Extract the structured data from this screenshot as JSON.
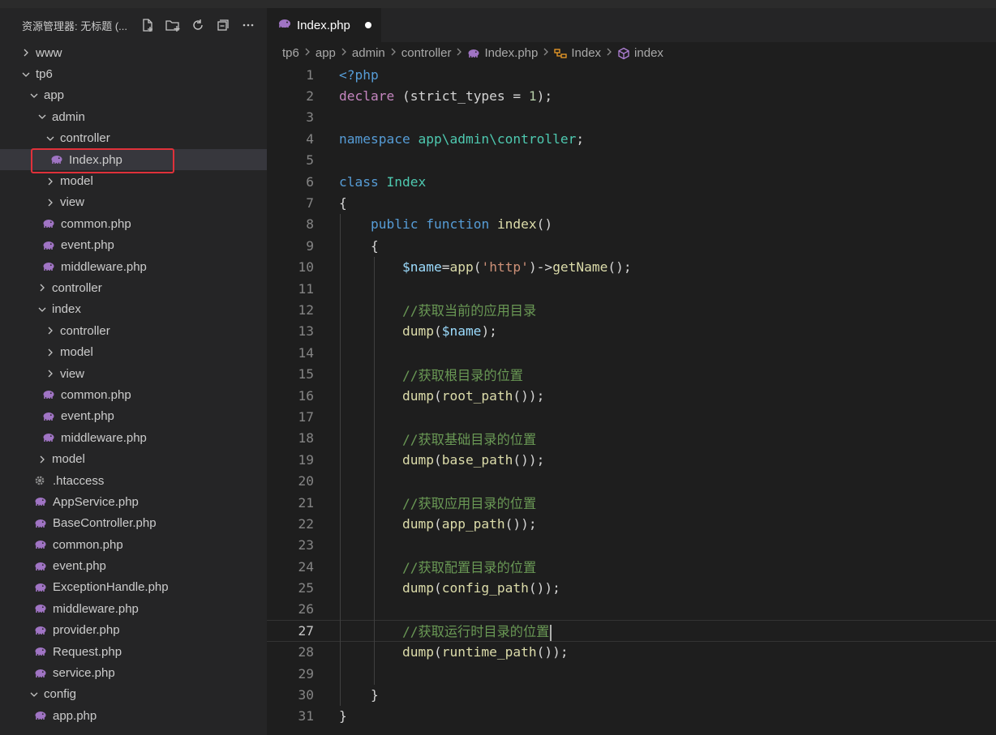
{
  "sidebar": {
    "title": "资源管理器: 无标题 (...",
    "actions": [
      "new-file-icon",
      "new-folder-icon",
      "refresh-icon",
      "collapse-all-icon",
      "more-icon"
    ],
    "tree": [
      {
        "label": "www",
        "type": "folder",
        "open": false,
        "indent": 0
      },
      {
        "label": "tp6",
        "type": "folder",
        "open": true,
        "indent": 0
      },
      {
        "label": "app",
        "type": "folder",
        "open": true,
        "indent": 1
      },
      {
        "label": "admin",
        "type": "folder",
        "open": true,
        "indent": 2
      },
      {
        "label": "controller",
        "type": "folder",
        "open": true,
        "indent": 3
      },
      {
        "label": "Index.php",
        "type": "php",
        "indent": 4,
        "selected": true
      },
      {
        "label": "model",
        "type": "folder",
        "open": false,
        "indent": 3
      },
      {
        "label": "view",
        "type": "folder",
        "open": false,
        "indent": 3
      },
      {
        "label": "common.php",
        "type": "php",
        "indent": 3
      },
      {
        "label": "event.php",
        "type": "php",
        "indent": 3
      },
      {
        "label": "middleware.php",
        "type": "php",
        "indent": 3
      },
      {
        "label": "controller",
        "type": "folder",
        "open": false,
        "indent": 2
      },
      {
        "label": "index",
        "type": "folder",
        "open": true,
        "indent": 2
      },
      {
        "label": "controller",
        "type": "folder",
        "open": false,
        "indent": 3
      },
      {
        "label": "model",
        "type": "folder",
        "open": false,
        "indent": 3
      },
      {
        "label": "view",
        "type": "folder",
        "open": false,
        "indent": 3
      },
      {
        "label": "common.php",
        "type": "php",
        "indent": 3
      },
      {
        "label": "event.php",
        "type": "php",
        "indent": 3
      },
      {
        "label": "middleware.php",
        "type": "php",
        "indent": 3
      },
      {
        "label": "model",
        "type": "folder",
        "open": false,
        "indent": 2
      },
      {
        "label": ".htaccess",
        "type": "gear",
        "indent": 2
      },
      {
        "label": "AppService.php",
        "type": "php",
        "indent": 2
      },
      {
        "label": "BaseController.php",
        "type": "php",
        "indent": 2
      },
      {
        "label": "common.php",
        "type": "php",
        "indent": 2
      },
      {
        "label": "event.php",
        "type": "php",
        "indent": 2
      },
      {
        "label": "ExceptionHandle.php",
        "type": "php",
        "indent": 2
      },
      {
        "label": "middleware.php",
        "type": "php",
        "indent": 2
      },
      {
        "label": "provider.php",
        "type": "php",
        "indent": 2
      },
      {
        "label": "Request.php",
        "type": "php",
        "indent": 2
      },
      {
        "label": "service.php",
        "type": "php",
        "indent": 2
      },
      {
        "label": "config",
        "type": "folder",
        "open": true,
        "indent": 1
      },
      {
        "label": "app.php",
        "type": "php",
        "indent": 2
      }
    ]
  },
  "editor": {
    "tab_label": "Index.php",
    "breadcrumb": [
      {
        "label": "tp6",
        "icon": ""
      },
      {
        "label": "app",
        "icon": ""
      },
      {
        "label": "admin",
        "icon": ""
      },
      {
        "label": "controller",
        "icon": ""
      },
      {
        "label": "Index.php",
        "icon": "php-icon"
      },
      {
        "label": "Index",
        "icon": "class-icon"
      },
      {
        "label": "index",
        "icon": "method-icon"
      }
    ],
    "current_line": 27,
    "lines": [
      [
        [
          "tagc",
          "<?php"
        ]
      ],
      [
        [
          "kw-purple",
          "declare"
        ],
        [
          "plain",
          " (strict_types = "
        ],
        [
          "num",
          "1"
        ],
        [
          "plain",
          ");"
        ]
      ],
      [],
      [
        [
          "kw-blue",
          "namespace"
        ],
        [
          "plain",
          " "
        ],
        [
          "cls",
          "app\\admin\\controller"
        ],
        [
          "plain",
          ";"
        ]
      ],
      [],
      [
        [
          "kw-blue",
          "class"
        ],
        [
          "plain",
          " "
        ],
        [
          "cls",
          "Index"
        ]
      ],
      [
        [
          "plain",
          "{"
        ]
      ],
      [
        [
          "plain",
          "    "
        ],
        [
          "kw-blue",
          "public"
        ],
        [
          "plain",
          " "
        ],
        [
          "kw-blue",
          "function"
        ],
        [
          "plain",
          " "
        ],
        [
          "fn",
          "index"
        ],
        [
          "plain",
          "()"
        ]
      ],
      [
        [
          "plain",
          "    {"
        ]
      ],
      [
        [
          "plain",
          "        "
        ],
        [
          "var",
          "$name"
        ],
        [
          "plain",
          "="
        ],
        [
          "fn",
          "app"
        ],
        [
          "plain",
          "("
        ],
        [
          "str",
          "'http'"
        ],
        [
          "plain",
          ")->"
        ],
        [
          "fn",
          "getName"
        ],
        [
          "plain",
          "();"
        ]
      ],
      [],
      [
        [
          "plain",
          "        "
        ],
        [
          "cmt",
          "//获取当前的应用目录"
        ]
      ],
      [
        [
          "plain",
          "        "
        ],
        [
          "fn",
          "dump"
        ],
        [
          "plain",
          "("
        ],
        [
          "var",
          "$name"
        ],
        [
          "plain",
          ");"
        ]
      ],
      [],
      [
        [
          "plain",
          "        "
        ],
        [
          "cmt",
          "//获取根目录的位置"
        ]
      ],
      [
        [
          "plain",
          "        "
        ],
        [
          "fn",
          "dump"
        ],
        [
          "plain",
          "("
        ],
        [
          "fn",
          "root_path"
        ],
        [
          "plain",
          "());"
        ]
      ],
      [],
      [
        [
          "plain",
          "        "
        ],
        [
          "cmt",
          "//获取基础目录的位置"
        ]
      ],
      [
        [
          "plain",
          "        "
        ],
        [
          "fn",
          "dump"
        ],
        [
          "plain",
          "("
        ],
        [
          "fn",
          "base_path"
        ],
        [
          "plain",
          "());"
        ]
      ],
      [],
      [
        [
          "plain",
          "        "
        ],
        [
          "cmt",
          "//获取应用目录的位置"
        ]
      ],
      [
        [
          "plain",
          "        "
        ],
        [
          "fn",
          "dump"
        ],
        [
          "plain",
          "("
        ],
        [
          "fn",
          "app_path"
        ],
        [
          "plain",
          "());"
        ]
      ],
      [],
      [
        [
          "plain",
          "        "
        ],
        [
          "cmt",
          "//获取配置目录的位置"
        ]
      ],
      [
        [
          "plain",
          "        "
        ],
        [
          "fn",
          "dump"
        ],
        [
          "plain",
          "("
        ],
        [
          "fn",
          "config_path"
        ],
        [
          "plain",
          "());"
        ]
      ],
      [],
      [
        [
          "plain",
          "        "
        ],
        [
          "cmt",
          "//获取运行时目录的位置"
        ]
      ],
      [
        [
          "plain",
          "        "
        ],
        [
          "fn",
          "dump"
        ],
        [
          "plain",
          "("
        ],
        [
          "fn",
          "runtime_path"
        ],
        [
          "plain",
          "());"
        ]
      ],
      [],
      [
        [
          "plain",
          "    }"
        ]
      ],
      [
        [
          "plain",
          "}"
        ]
      ]
    ]
  }
}
